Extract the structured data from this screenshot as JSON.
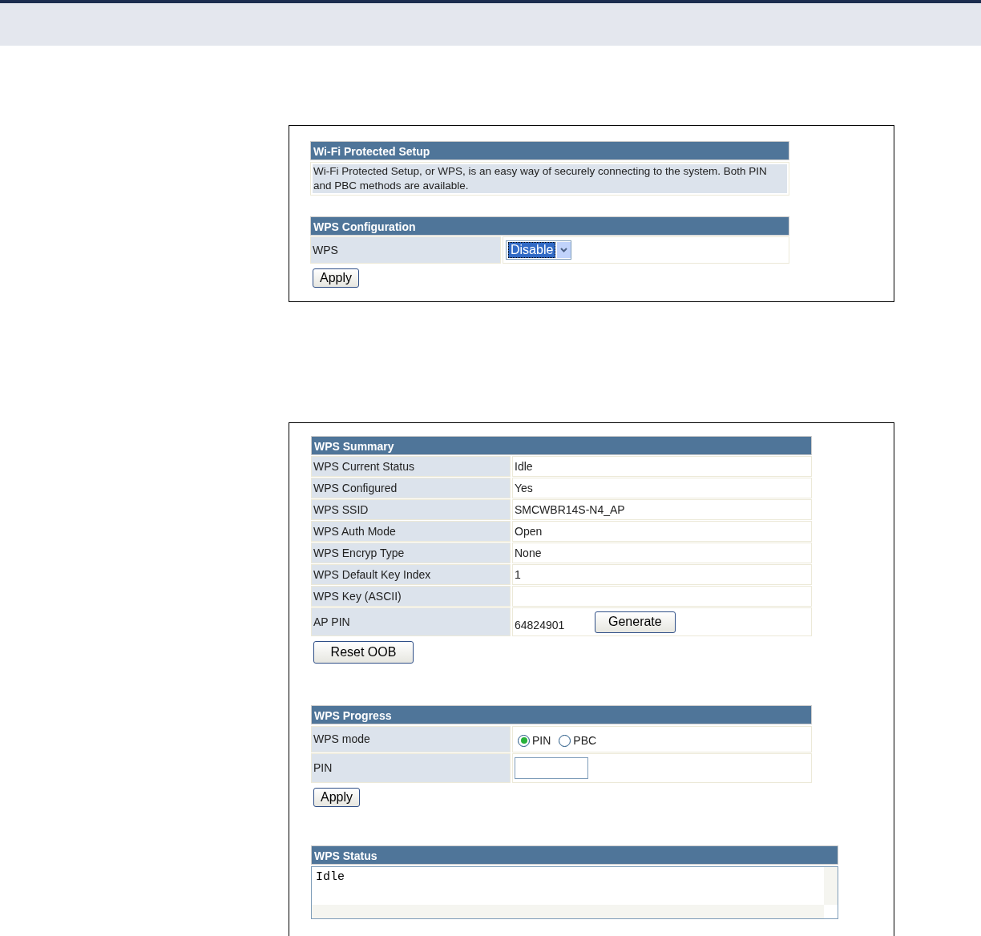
{
  "panel_1": {
    "intro": {
      "title": "Wi-Fi Protected Setup",
      "text": "Wi-Fi Protected Setup, or WPS, is an easy way of securely connecting to the system. Both PIN and PBC methods are available."
    },
    "configuration": {
      "title": "WPS Configuration",
      "label": "WPS",
      "value": "Disable"
    },
    "apply_button": "Apply"
  },
  "panel_2": {
    "summary": {
      "title": "WPS Summary",
      "rows": [
        {
          "kind": "text",
          "label": "WPS Current Status",
          "value": "Idle"
        },
        {
          "kind": "text",
          "label": "WPS Configured",
          "value": "Yes"
        },
        {
          "kind": "text",
          "label": "WPS SSID",
          "value": "SMCWBR14S-N4_AP"
        },
        {
          "kind": "text",
          "label": "WPS Auth Mode",
          "value": "Open"
        },
        {
          "kind": "text",
          "label": "WPS Encryp Type",
          "value": "None"
        },
        {
          "kind": "text",
          "label": "WPS Default Key Index",
          "value": "1"
        },
        {
          "kind": "text",
          "label": "WPS Key (ASCII)"
        },
        {
          "kind": "pin",
          "label": "AP PIN",
          "value": "64824901",
          "button": "Generate"
        }
      ]
    },
    "reset_button": "Reset OOB",
    "progress": {
      "title": "WPS Progress",
      "mode_label": "WPS mode",
      "modes": [
        {
          "label": "PIN",
          "selected": true
        },
        {
          "label": "PBC",
          "selected": false
        }
      ],
      "pin_label": "PIN"
    },
    "apply_button": "Apply",
    "status": {
      "title": "WPS Status",
      "text": "Idle"
    }
  }
}
